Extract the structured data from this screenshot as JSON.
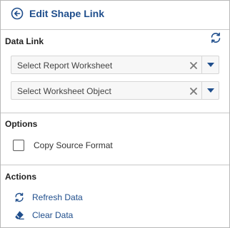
{
  "header": {
    "title": "Edit Shape Link",
    "back_icon": "back-arrow-circle-icon"
  },
  "data_link": {
    "title": "Data Link",
    "refresh_icon": "refresh-icon",
    "worksheet_select": {
      "placeholder": "Select Report Worksheet"
    },
    "object_select": {
      "placeholder": "Select Worksheet Object"
    }
  },
  "options": {
    "title": "Options",
    "copy_source_format": {
      "label": "Copy Source Format",
      "checked": false
    }
  },
  "actions": {
    "title": "Actions",
    "refresh": {
      "label": "Refresh Data",
      "icon": "refresh-icon"
    },
    "clear": {
      "label": "Clear Data",
      "icon": "eraser-icon"
    }
  },
  "colors": {
    "accent": "#1f4e8c",
    "divider": "#c9c9c9"
  }
}
